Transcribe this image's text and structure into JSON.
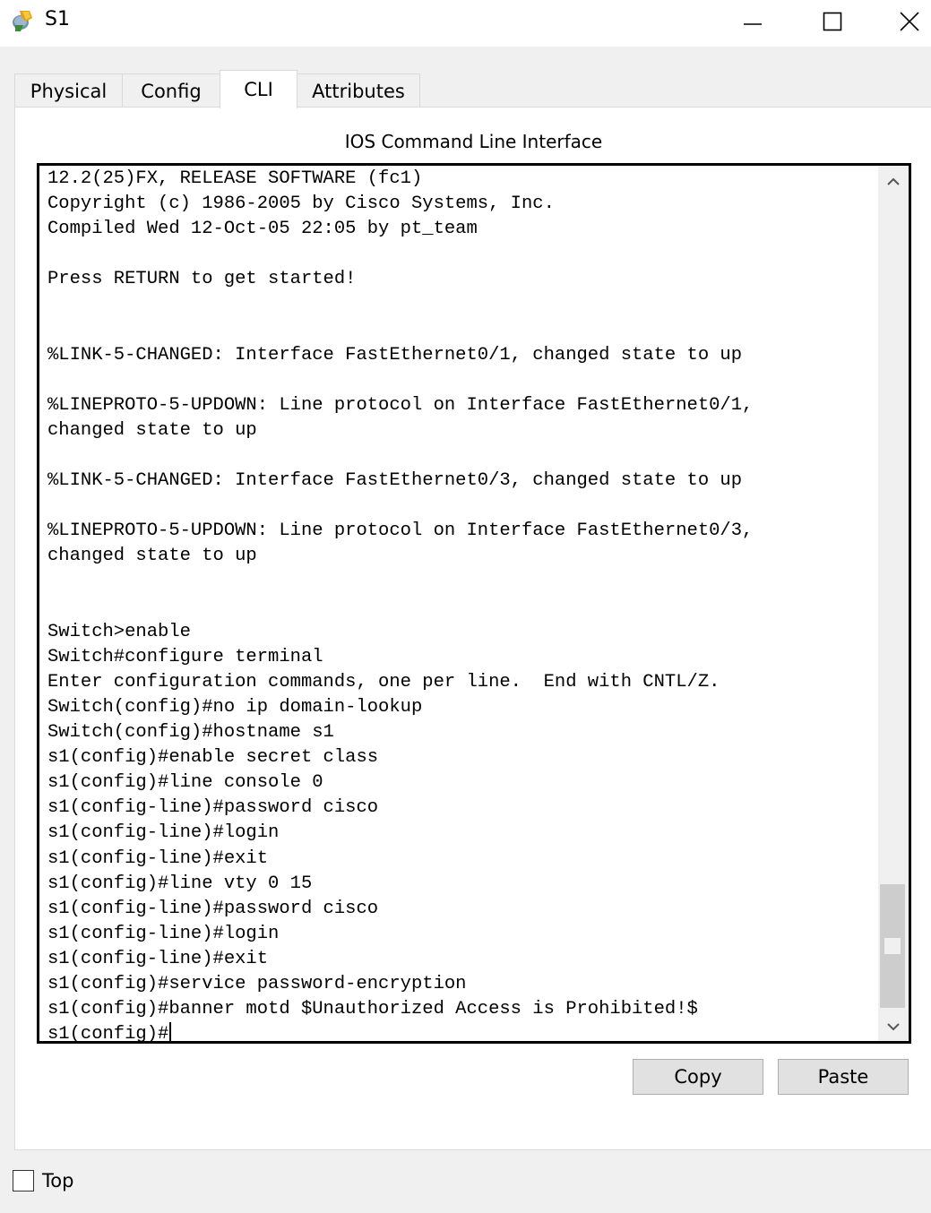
{
  "window": {
    "title": "S1",
    "app_icon": "packet-tracer-switch-icon",
    "controls": {
      "minimize_icon": "minimize-icon",
      "maximize_icon": "maximize-icon",
      "close_icon": "close-icon"
    }
  },
  "tabs": [
    {
      "label": "Physical",
      "active": false
    },
    {
      "label": "Config",
      "active": false
    },
    {
      "label": "CLI",
      "active": true
    },
    {
      "label": "Attributes",
      "active": false
    }
  ],
  "panel": {
    "title": "IOS Command Line Interface"
  },
  "terminal": {
    "lines": [
      "12.2(25)FX, RELEASE SOFTWARE (fc1)",
      "Copyright (c) 1986-2005 by Cisco Systems, Inc.",
      "Compiled Wed 12-Oct-05 22:05 by pt_team",
      "",
      "Press RETURN to get started!",
      "",
      "",
      "%LINK-5-CHANGED: Interface FastEthernet0/1, changed state to up",
      "",
      "%LINEPROTO-5-UPDOWN: Line protocol on Interface FastEthernet0/1,",
      "changed state to up",
      "",
      "%LINK-5-CHANGED: Interface FastEthernet0/3, changed state to up",
      "",
      "%LINEPROTO-5-UPDOWN: Line protocol on Interface FastEthernet0/3,",
      "changed state to up",
      "",
      "",
      "Switch>enable",
      "Switch#configure terminal",
      "Enter configuration commands, one per line.  End with CNTL/Z.",
      "Switch(config)#no ip domain-lookup",
      "Switch(config)#hostname s1",
      "s1(config)#enable secret class",
      "s1(config)#line console 0",
      "s1(config-line)#password cisco",
      "s1(config-line)#login",
      "s1(config-line)#exit",
      "s1(config)#line vty 0 15",
      "s1(config-line)#password cisco",
      "s1(config-line)#login",
      "s1(config-line)#exit",
      "s1(config)#service password-encryption",
      "s1(config)#banner motd $Unauthorized Access is Prohibited!$",
      "s1(config)#"
    ],
    "scrollbar": {
      "up_icon": "scroll-up-arrow-icon",
      "down_icon": "scroll-down-arrow-icon",
      "position": "bottom"
    }
  },
  "buttons": {
    "copy": "Copy",
    "paste": "Paste"
  },
  "top_checkbox": {
    "label": "Top",
    "checked": false
  }
}
